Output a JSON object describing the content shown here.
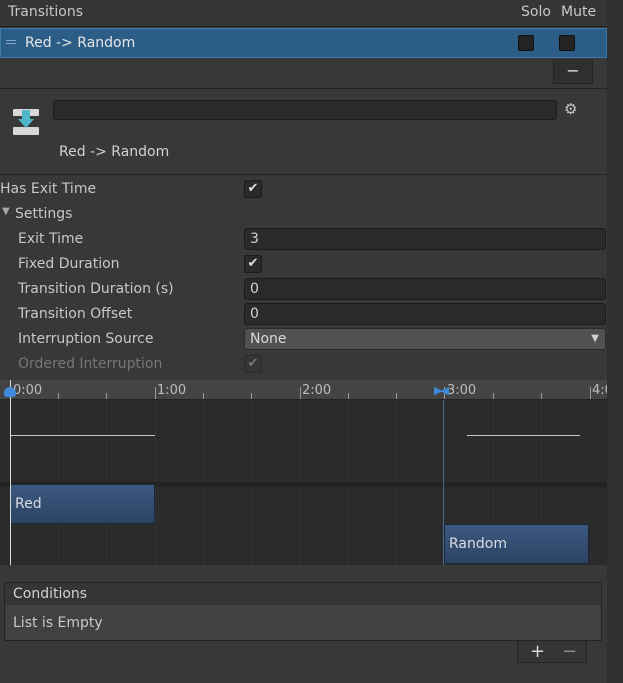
{
  "transitions_list": {
    "header_title": "Transitions",
    "col_solo": "Solo",
    "col_mute": "Mute",
    "selected_row_label": "Red -> Random",
    "remove_button": "−"
  },
  "inspector": {
    "transition_name_value": "",
    "subtitle": "Red -> Random",
    "has_exit_time_label": "Has Exit Time",
    "settings_label": "Settings",
    "exit_time_label": "Exit Time",
    "exit_time_value": "3",
    "fixed_duration_label": "Fixed Duration",
    "transition_duration_label": "Transition Duration (s)",
    "transition_duration_value": "0",
    "transition_offset_label": "Transition Offset",
    "transition_offset_value": "0",
    "interruption_source_label": "Interruption Source",
    "interruption_source_value": "None",
    "ordered_interruption_label": "Ordered Interruption"
  },
  "timeline": {
    "ruler_labels": [
      "0:00",
      "1:00",
      "2:00",
      "3:00",
      "4:0"
    ],
    "source_clip": "Red",
    "dest_clip": "Random"
  },
  "conditions": {
    "header": "Conditions",
    "empty_text": "List is Empty",
    "add_button": "+",
    "remove_button": "−"
  },
  "colors": {
    "selection": "#2c5d87",
    "accent": "#3e8ad8",
    "clip": "#3e5a80"
  }
}
